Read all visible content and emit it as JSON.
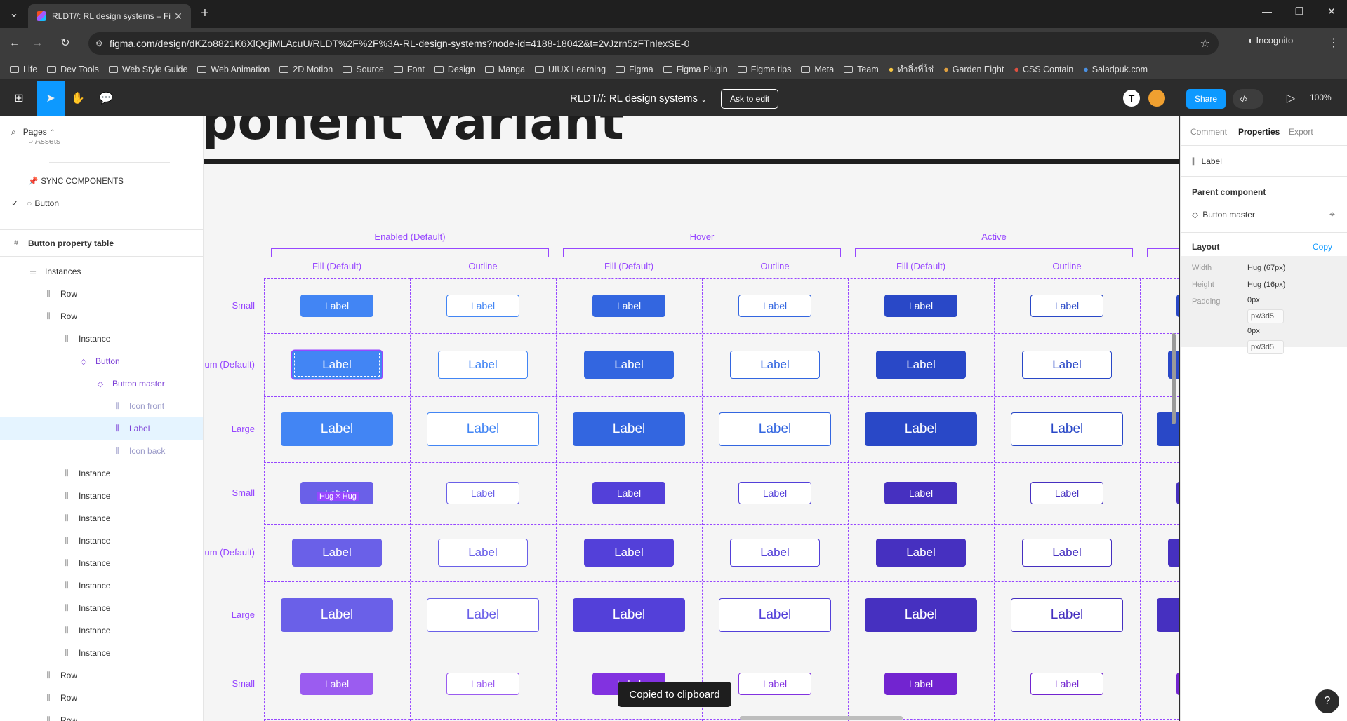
{
  "browser": {
    "tab_title": "RLDT//: RL design systems – Fig",
    "url": "figma.com/design/dKZo8821K6XlQcjiMLAcuU/RLDT%2F%2F%3A-RL-design-systems?node-id=4188-18042&t=2vJzrn5zFTnlexSE-0",
    "incognito": "Incognito",
    "bookmarks": [
      "Life",
      "Dev Tools",
      "Web Style Guide",
      "Web Animation",
      "2D Motion",
      "Source",
      "Font",
      "Design",
      "Manga",
      "UIUX Learning",
      "Figma",
      "Figma Plugin",
      "Figma tips",
      "Meta",
      "Team",
      "ทำสิ่งที่ใช่",
      "Garden Eight",
      "CSS Contain",
      "Saladpuk.com"
    ]
  },
  "toolbar": {
    "doc_title": "RLDT//: RL design systems",
    "ask_to_edit": "Ask to edit",
    "avatar_letter": "T",
    "share": "Share",
    "zoom": "100%"
  },
  "layers": {
    "pages_label": "Pages",
    "assets_label": "Assets",
    "sync_components": "SYNC COMPONENTS",
    "button_page": "Button",
    "frame": "Button property table",
    "items": [
      {
        "label": "Instances"
      },
      {
        "label": "Row"
      },
      {
        "label": "Row"
      },
      {
        "label": "Instance"
      },
      {
        "label": "Button"
      },
      {
        "label": "Button master"
      },
      {
        "label": "Icon front"
      },
      {
        "label": "Label"
      },
      {
        "label": "Icon back"
      },
      {
        "label": "Instance"
      },
      {
        "label": "Instance"
      },
      {
        "label": "Instance"
      },
      {
        "label": "Instance"
      },
      {
        "label": "Instance"
      },
      {
        "label": "Instance"
      },
      {
        "label": "Instance"
      },
      {
        "label": "Instance"
      },
      {
        "label": "Instance"
      },
      {
        "label": "Row"
      },
      {
        "label": "Row"
      },
      {
        "label": "Row"
      }
    ]
  },
  "canvas": {
    "heading": "ponent variant",
    "groups": [
      "Enabled (Default)",
      "Hover",
      "Active"
    ],
    "columns": [
      "Fill (Default)",
      "Outline",
      "Fill (Default)",
      "Outline",
      "Fill (Default)",
      "Outline"
    ],
    "rows": [
      "Small",
      "ium (Default)",
      "Large",
      "Small",
      "ium (Default)",
      "Large",
      "Small"
    ],
    "button_label": "Label",
    "hug_badge": "Hug × Hug",
    "toast": "Copied to clipboard",
    "colors": {
      "blue": [
        "#4285f4",
        "#3366e0",
        "#2948c7"
      ],
      "indigo": [
        "#6a60e8",
        "#5340d9",
        "#4630c0"
      ],
      "violet": [
        "#9b5cf0",
        "#8232e0",
        "#7224d0"
      ],
      "guide": "#9747ff"
    }
  },
  "properties": {
    "tabs": [
      "Comment",
      "Properties",
      "Export"
    ],
    "selected_layer": "Label",
    "parent_component_title": "Parent component",
    "parent_component": "Button master",
    "layout_title": "Layout",
    "copy": "Copy",
    "width_label": "Width",
    "width_value": "Hug (67px)",
    "height_label": "Height",
    "height_value": "Hug (16px)",
    "padding_label": "Padding",
    "padding_h": "0px",
    "padding_h_var": "px/3d5",
    "padding_v": "0px",
    "padding_v_var": "px/3d5"
  }
}
